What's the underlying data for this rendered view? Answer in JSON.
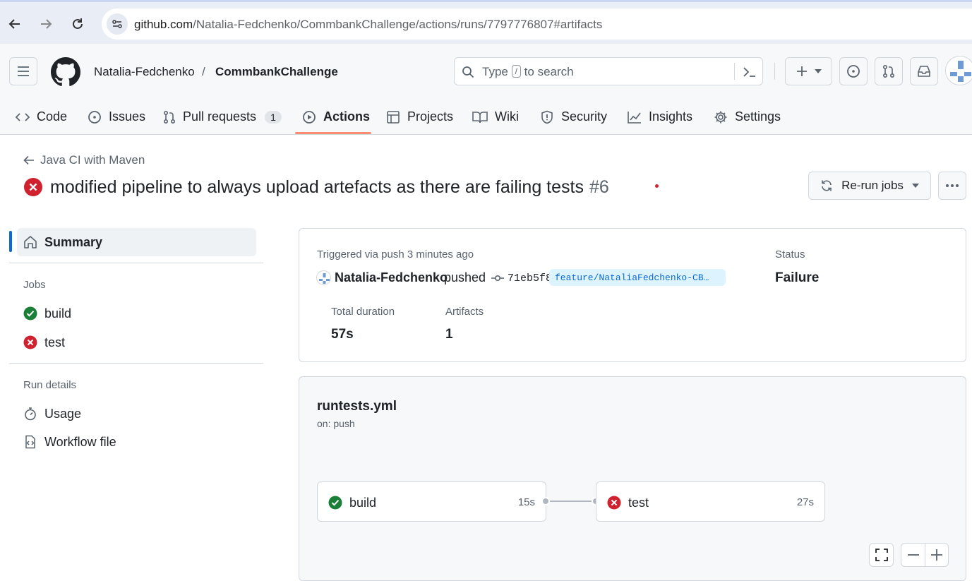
{
  "browser": {
    "url_host": "github.com",
    "url_path": "/Natalia-Fedchenko/CommbankChallenge/actions/runs/7797776807#artifacts"
  },
  "header": {
    "owner": "Natalia-Fedchenko",
    "separator": "/",
    "repo": "CommbankChallenge",
    "search_prefix": "Type",
    "search_key": "/",
    "search_suffix": "to search"
  },
  "tabs": [
    {
      "label": "Code",
      "icon": "code-icon"
    },
    {
      "label": "Issues",
      "icon": "issue-icon"
    },
    {
      "label": "Pull requests",
      "icon": "pull-request-icon",
      "count": "1"
    },
    {
      "label": "Actions",
      "icon": "play-icon",
      "active": true
    },
    {
      "label": "Projects",
      "icon": "table-icon"
    },
    {
      "label": "Wiki",
      "icon": "book-icon"
    },
    {
      "label": "Security",
      "icon": "shield-icon"
    },
    {
      "label": "Insights",
      "icon": "graph-icon"
    },
    {
      "label": "Settings",
      "icon": "gear-icon"
    }
  ],
  "run": {
    "workflow_name": "Java CI with Maven",
    "title": "modified pipeline to always upload artefacts as there are failing tests",
    "number": "#6",
    "rerun_label": "Re-run jobs"
  },
  "sidebar": {
    "summary_label": "Summary",
    "jobs_heading": "Jobs",
    "jobs": [
      {
        "label": "build",
        "status": "success"
      },
      {
        "label": "test",
        "status": "failure"
      }
    ],
    "run_details_heading": "Run details",
    "details": [
      {
        "label": "Usage",
        "icon": "stopwatch-icon"
      },
      {
        "label": "Workflow file",
        "icon": "file-code-icon"
      }
    ]
  },
  "summary": {
    "trigger_text": "Triggered via push 3 minutes ago",
    "actor": "Natalia-Fedchenko",
    "action": "pushed",
    "commit": "71eb5f8",
    "branch": "feature/NataliaFedchenko-CB…",
    "status_label": "Status",
    "status_value": "Failure",
    "duration_label": "Total duration",
    "duration_value": "57s",
    "artifacts_label": "Artifacts",
    "artifacts_value": "1"
  },
  "workflow": {
    "file": "runtests.yml",
    "trigger": "on: push",
    "jobs": [
      {
        "name": "build",
        "duration": "15s",
        "status": "success"
      },
      {
        "name": "test",
        "duration": "27s",
        "status": "failure"
      }
    ]
  },
  "colors": {
    "success": "#1a7f37",
    "failure": "#cf222e",
    "accent": "#0969da",
    "tab_underline": "#fd8c73"
  }
}
